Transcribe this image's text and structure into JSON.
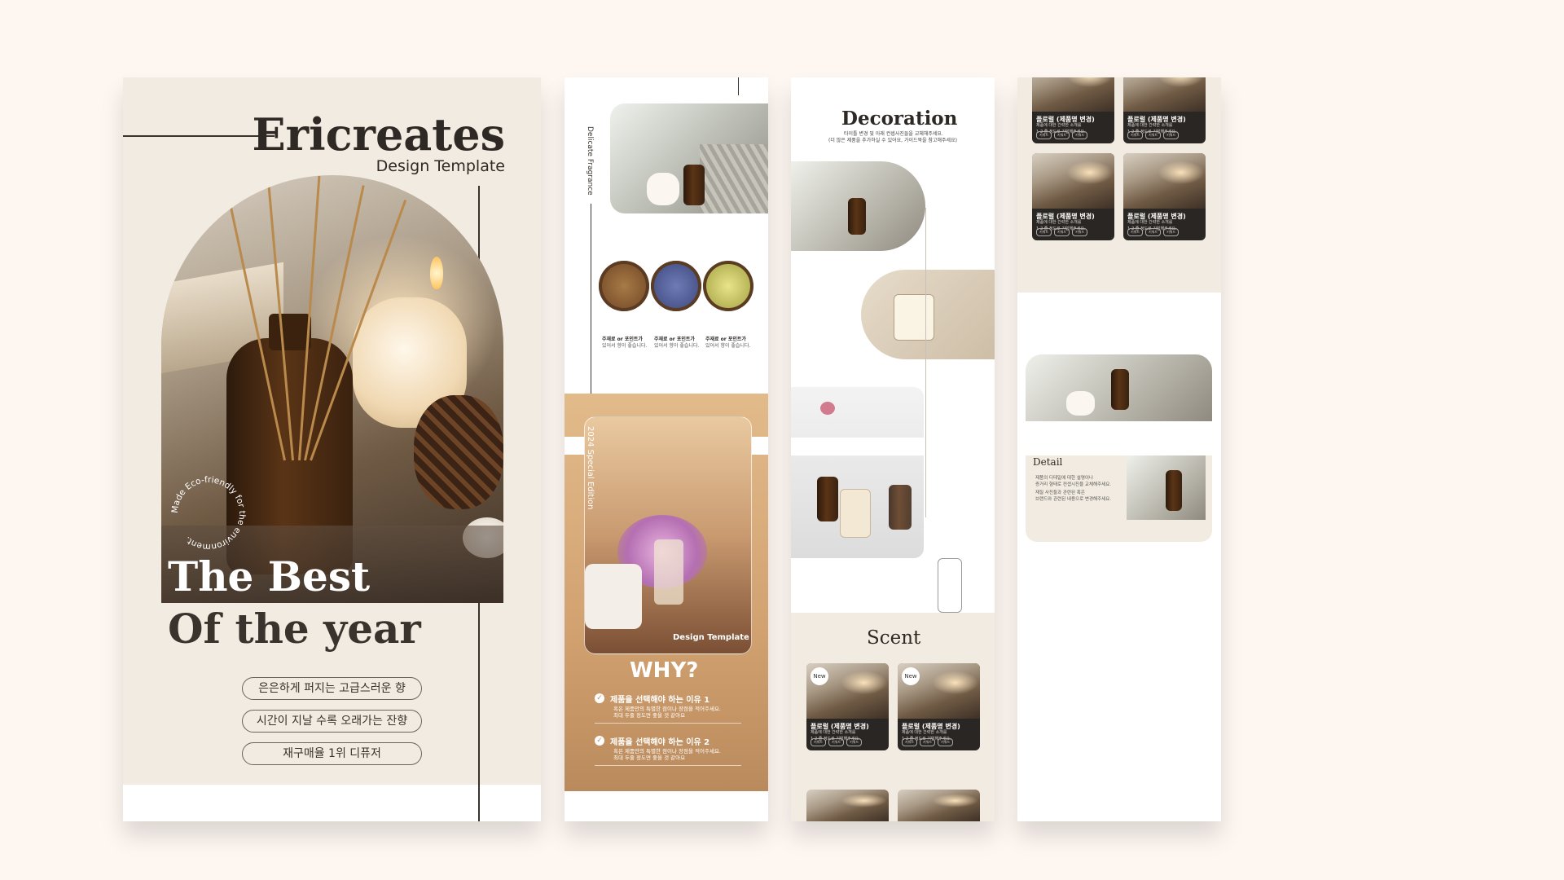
{
  "cover": {
    "brand": "Ericreates",
    "subtitle": "Design Template",
    "circle_text": "Made Eco-friendly for the environment.",
    "headline_line1": "The Best",
    "headline_line2": "Of the year",
    "features": [
      "은은하게 퍼지는 고급스러운 향",
      "시간이 지날 수록 오래가는 잔향",
      "재구매율 1위 디퓨저"
    ]
  },
  "col2": {
    "vertical_label": "Delicate Fragrance",
    "ingredients": [
      {
        "title": "주재료 or 포인트가",
        "desc": "있어서 향이 좋습니다."
      },
      {
        "title": "주재료 or 포인트가",
        "desc": "있어서 향이 좋습니다."
      },
      {
        "title": "주재료 or 포인트가",
        "desc": "있어서 향이 좋습니다."
      }
    ],
    "edition_label": "2024 Special Edition",
    "photo_caption": "Design Template",
    "why_title": "WHY?",
    "reasons": [
      {
        "title": "제품을 선택해야 하는 이유 1",
        "desc1": "혹은 제품만의 특별한 점이나 장점을 적어주세요.",
        "desc2": "최대 두줄 정도면 좋을 것 같아요"
      },
      {
        "title": "제품을 선택해야 하는 이유 2",
        "desc1": "혹은 제품만의 특별한 점이나 장점을 적어주세요.",
        "desc2": "최대 두줄 정도면 좋을 것 같아요"
      }
    ]
  },
  "col3": {
    "decoration_title": "Decoration",
    "decoration_desc1": "타이틀 변경 및 아래 컨셉사진들을 교체해주세요.",
    "decoration_desc2": "(더 많은 제품을 추가하실 수 있어요, 가이드북을 참고해주세요)",
    "scent_title": "Scent",
    "new_badge": "New",
    "cards": [
      {
        "title": "플로럴 (제품명 변경)",
        "desc1": "제품에 대한 간략한 소개를",
        "desc2": "1-2 줄 정도로 기입해주세요.",
        "tags": [
          "키워드",
          "키워드",
          "키워드"
        ]
      },
      {
        "title": "플로럴 (제품명 변경)",
        "desc1": "제품에 대한 간략한 소개를",
        "desc2": "1-2 줄 정도로 기입해주세요.",
        "tags": [
          "키워드",
          "키워드",
          "키워드"
        ]
      }
    ]
  },
  "col4": {
    "cards": [
      {
        "title": "플로럴 (제품명 변경)",
        "desc1": "제품에 대한 간략한 소개를",
        "desc2": "1-2 줄 정도로 기입해주세요.",
        "tags": [
          "키워드",
          "키워드",
          "키워드"
        ]
      },
      {
        "title": "플로럴 (제품명 변경)",
        "desc1": "제품에 대한 간략한 소개를",
        "desc2": "1-2 줄 정도로 기입해주세요.",
        "tags": [
          "키워드",
          "키워드",
          "키워드"
        ]
      },
      {
        "title": "플로럴 (제품명 변경)",
        "desc1": "제품에 대한 간략한 소개를",
        "desc2": "1-2 줄 정도로 기입해주세요.",
        "tags": [
          "키워드",
          "키워드",
          "키워드"
        ]
      },
      {
        "title": "플로럴 (제품명 변경)",
        "desc1": "제품에 대한 간략한 소개를",
        "desc2": "1-2 줄 정도로 기입해주세요.",
        "tags": [
          "키워드",
          "키워드",
          "키워드"
        ]
      }
    ],
    "detail_title": "Detail",
    "detail_desc1": "제품의 디테일에 대한 설명이나",
    "detail_desc2": "증거리 형태로 컨셉시진을 교체해주세요.",
    "detail_desc3": "재질 사진들과 관련된 혹은",
    "detail_desc4": "브랜드와 관련된 내용으로 변경해주세요."
  },
  "colors": {
    "background": "#fdf6f1",
    "beige": "#f2ebe1",
    "tan": "#d9ad7c",
    "dark_text": "#2e2925",
    "card_dark": "#2a2623"
  }
}
